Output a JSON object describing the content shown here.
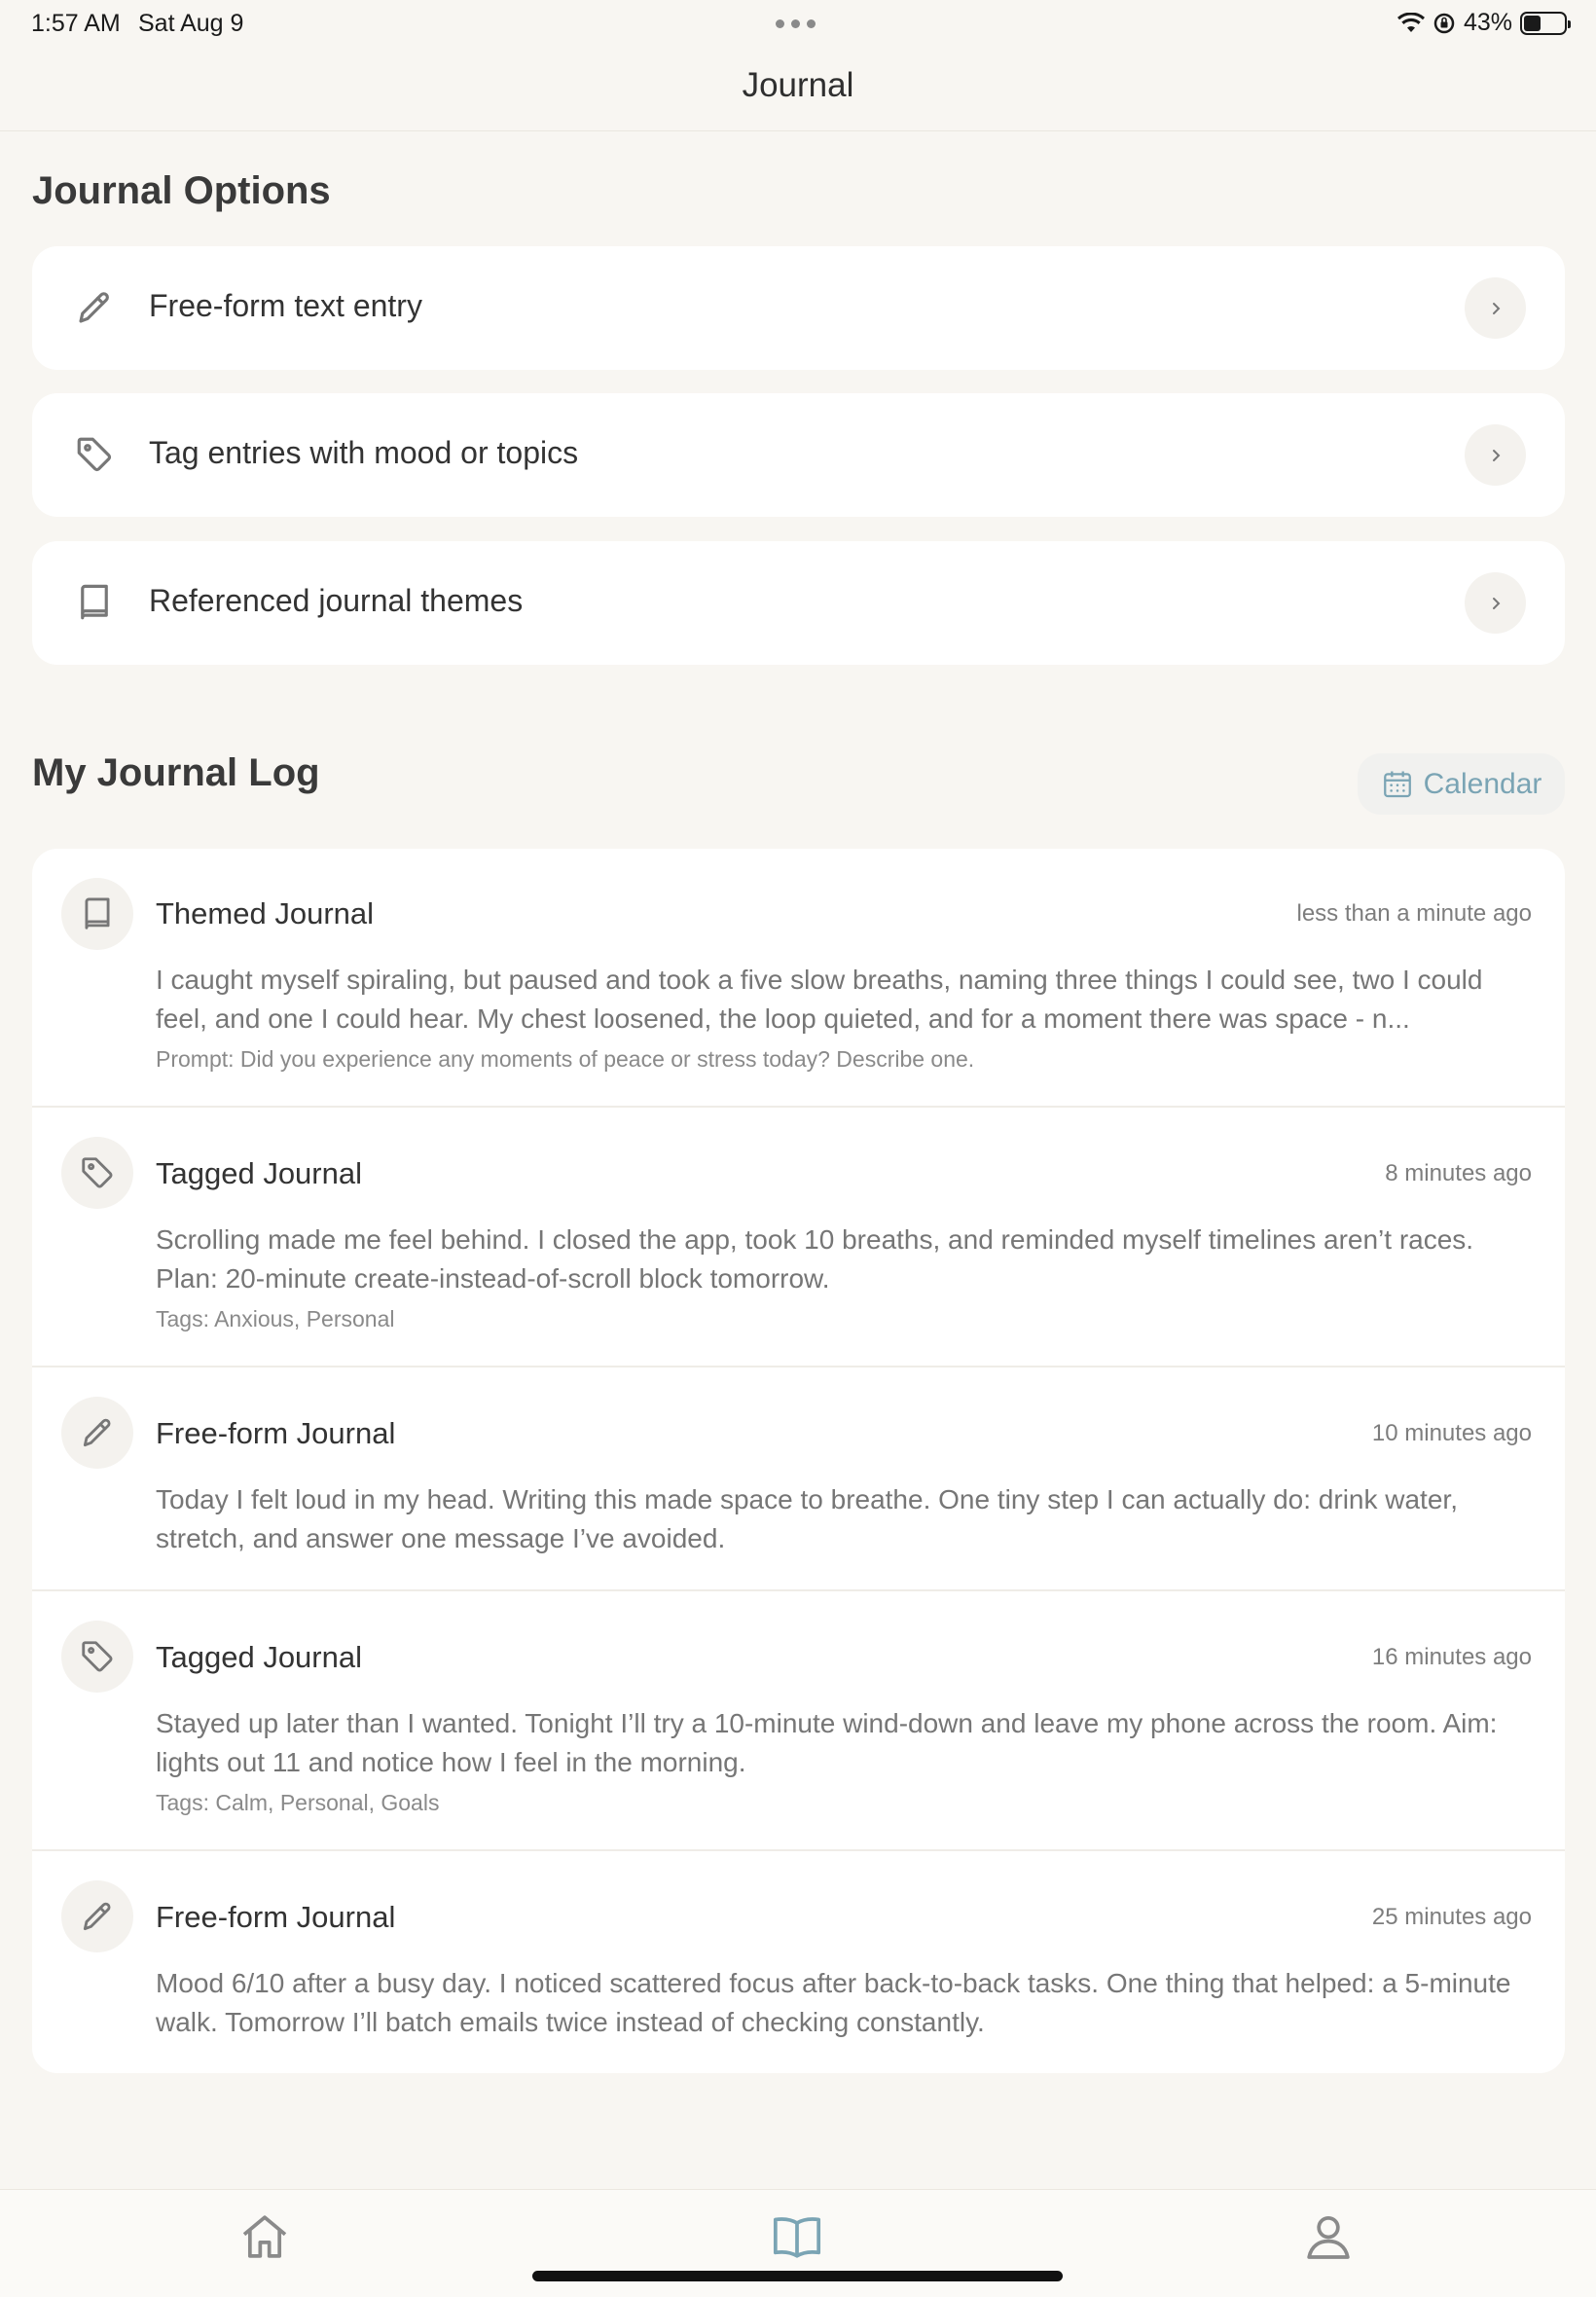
{
  "status_bar": {
    "time": "1:57 AM",
    "date": "Sat Aug 9",
    "battery_percent": "43%",
    "battery_level": 0.43,
    "icons": [
      "wifi-icon",
      "orientation-lock-icon",
      "battery-icon"
    ]
  },
  "nav": {
    "title": "Journal"
  },
  "options": {
    "heading": "Journal Options",
    "items": [
      {
        "icon": "pencil-icon",
        "label": "Free-form text entry"
      },
      {
        "icon": "tag-icon",
        "label": "Tag entries with mood or topics"
      },
      {
        "icon": "book-icon",
        "label": "Referenced journal themes"
      }
    ]
  },
  "log": {
    "heading": "My Journal Log",
    "calendar_label": "Calendar",
    "entries": [
      {
        "icon": "book-icon",
        "title": "Themed Journal",
        "time": "less than a minute ago",
        "text": "I caught myself spiraling, but paused and took a five slow breaths, naming three things I could see, two I could feel, and one I could hear. My chest loosened, the loop quieted, and for a moment there was space - n...",
        "meta": "Prompt: Did you experience any moments of peace or stress today? Describe one."
      },
      {
        "icon": "tag-icon",
        "title": "Tagged Journal",
        "time": "8 minutes ago",
        "text": "Scrolling made me feel behind. I closed the app, took 10 breaths, and reminded myself timelines aren’t races. Plan: 20-minute create-instead-of-scroll block tomorrow.",
        "meta": "Tags: Anxious, Personal"
      },
      {
        "icon": "pencil-icon",
        "title": "Free-form Journal",
        "time": "10 minutes ago",
        "text": "Today I felt loud in my head. Writing this made space to breathe. One tiny step I can actually do: drink water, stretch, and answer one message I’ve avoided.",
        "meta": ""
      },
      {
        "icon": "tag-icon",
        "title": "Tagged Journal",
        "time": "16 minutes ago",
        "text": "Stayed up later than I wanted. Tonight I’ll try a 10-minute wind-down and leave my phone across the room. Aim: lights out 11 and notice how I feel in the morning.",
        "meta": "Tags: Calm, Personal, Goals"
      },
      {
        "icon": "pencil-icon",
        "title": "Free-form Journal",
        "time": "25 minutes ago",
        "text": "Mood 6/10 after a busy day. I noticed scattered focus after back-to-back tasks. One thing that helped: a 5-minute walk. Tomorrow I’ll batch emails twice instead of checking constantly.",
        "meta": ""
      }
    ]
  },
  "tabbar": {
    "tabs": [
      {
        "icon": "home-icon",
        "active": false
      },
      {
        "icon": "open-book-icon",
        "active": true
      },
      {
        "icon": "profile-icon",
        "active": false
      }
    ]
  },
  "colors": {
    "background": "#f8f6f2",
    "card": "#ffffff",
    "accent": "#7aa4b4",
    "text": "#3a3a3a",
    "muted": "#767676"
  }
}
